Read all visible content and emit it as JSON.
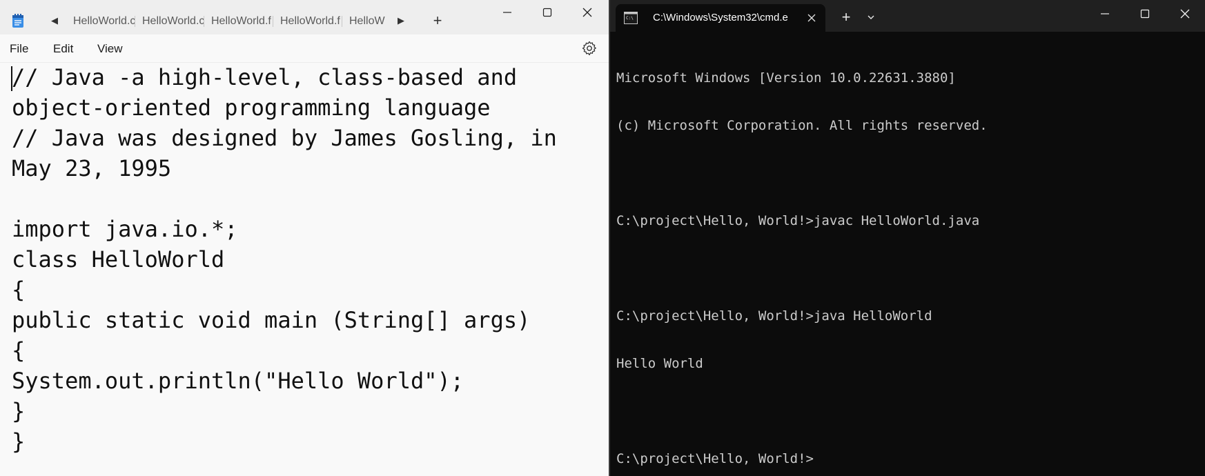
{
  "notepad": {
    "tabs": [
      "HelloWorld.c",
      "HelloWorld.c",
      "HelloWorld.f",
      "HelloWorld.f",
      "HelloW"
    ],
    "new_tab_label": "+",
    "menu": {
      "file": "File",
      "edit": "Edit",
      "view": "View"
    },
    "content": "// Java -a high-level, class-based and object-oriented programming language\n// Java was designed by James Gosling, in May 23, 1995\n\nimport java.io.*;\nclass HelloWorld\n{\npublic static void main (String[] args)\n{\nSystem.out.println(\"Hello World\");\n}\n}",
    "icons": {
      "app": "notepad-icon",
      "scroll_left": "chevron-left-icon",
      "scroll_right": "chevron-right-icon",
      "minimize": "minimize-icon",
      "maximize": "maximize-icon",
      "close": "close-icon",
      "settings": "gear-icon"
    }
  },
  "terminal": {
    "tab_title": "C:\\Windows\\System32\\cmd.e",
    "new_tab_label": "+",
    "lines": [
      "Microsoft Windows [Version 10.0.22631.3880]",
      "(c) Microsoft Corporation. All rights reserved.",
      "",
      "C:\\project\\Hello, World!>javac HelloWorld.java",
      "",
      "C:\\project\\Hello, World!>java HelloWorld",
      "Hello World",
      "",
      "C:\\project\\Hello, World!>"
    ],
    "icons": {
      "app": "cmd-icon",
      "tab_close": "close-icon",
      "dropdown": "chevron-down-icon",
      "minimize": "minimize-icon",
      "maximize": "maximize-icon",
      "close": "close-icon"
    }
  },
  "colors": {
    "notepad_bg": "#f9f9f9",
    "notepad_titlebar": "#eeeeee",
    "terminal_bg": "#0c0c0c",
    "terminal_titlebar": "#202020",
    "terminal_text": "#cccccc"
  }
}
